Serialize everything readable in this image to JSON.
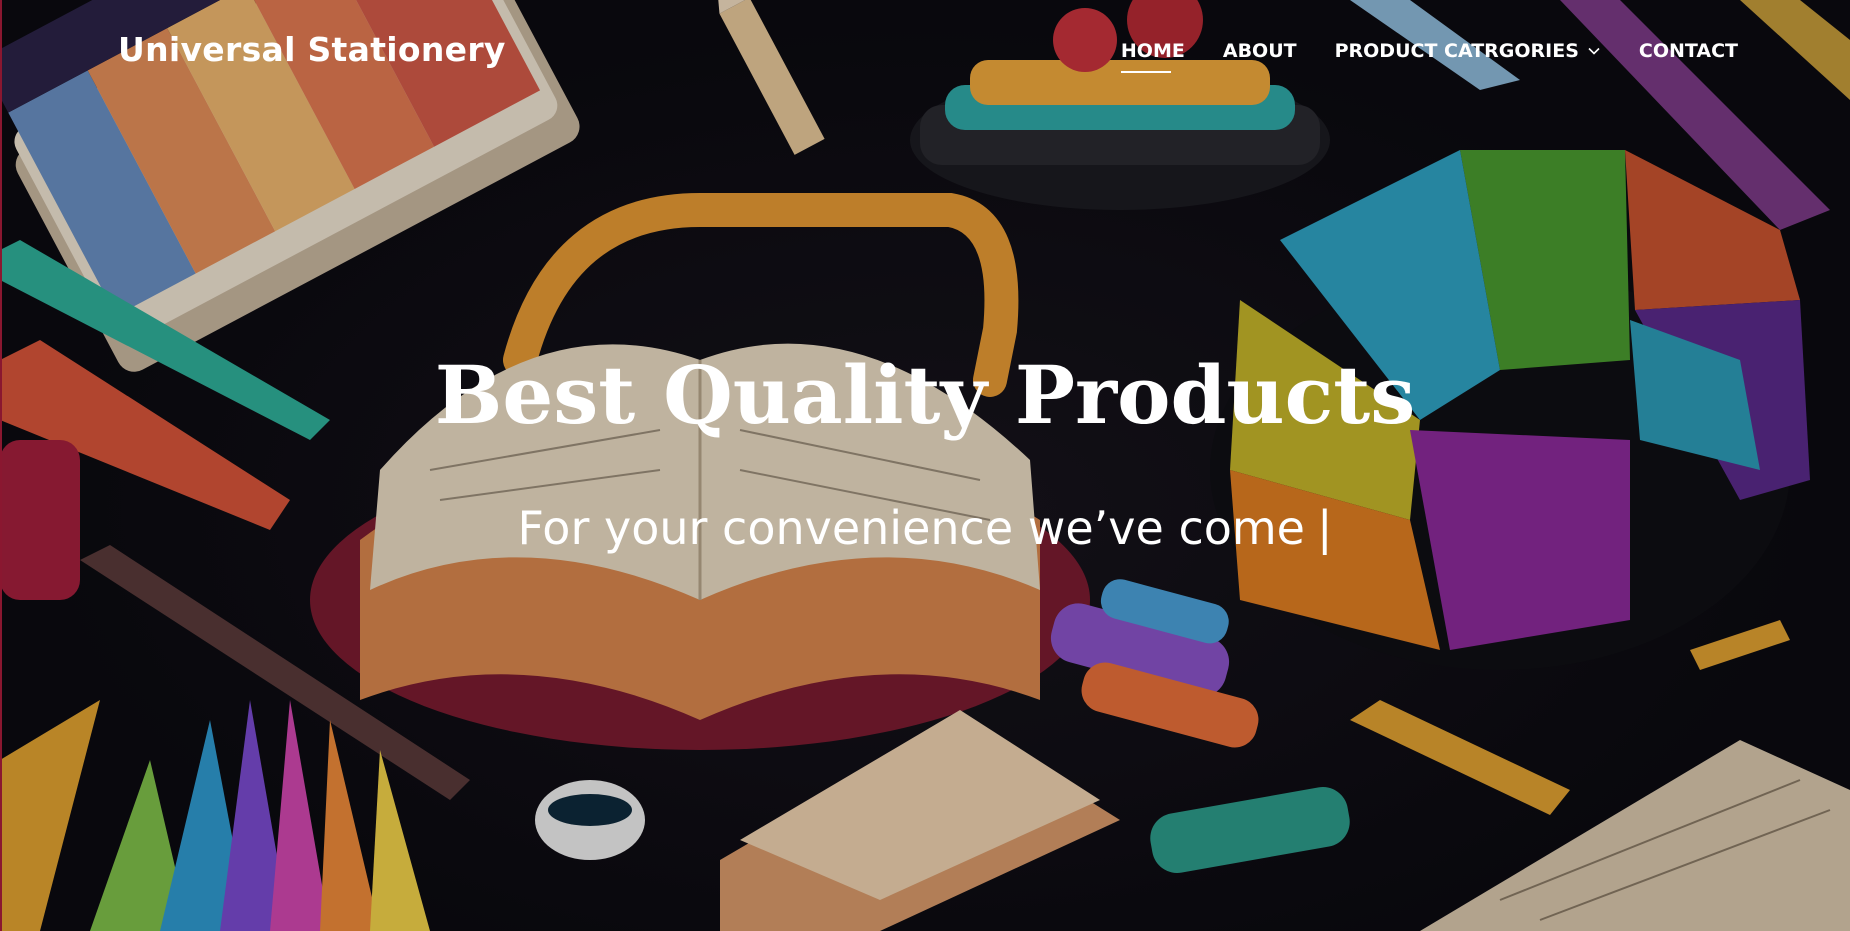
{
  "brand": {
    "name": "Universal Stationery"
  },
  "nav": {
    "items": [
      {
        "label": "HOME",
        "active": true
      },
      {
        "label": "ABOUT",
        "active": false
      },
      {
        "label": "PRODUCT CATRGORIES",
        "active": false,
        "dropdown": true,
        "icon": "chevron-down-icon"
      },
      {
        "label": "CONTACT",
        "active": false
      }
    ]
  },
  "hero": {
    "title": "Best Quality Products",
    "subtitle": "For your convenience we’ve come",
    "cursor": "|"
  },
  "colors": {
    "text": "#ffffff",
    "background": "#0b0b10",
    "accent_edge": "#8a1730"
  }
}
